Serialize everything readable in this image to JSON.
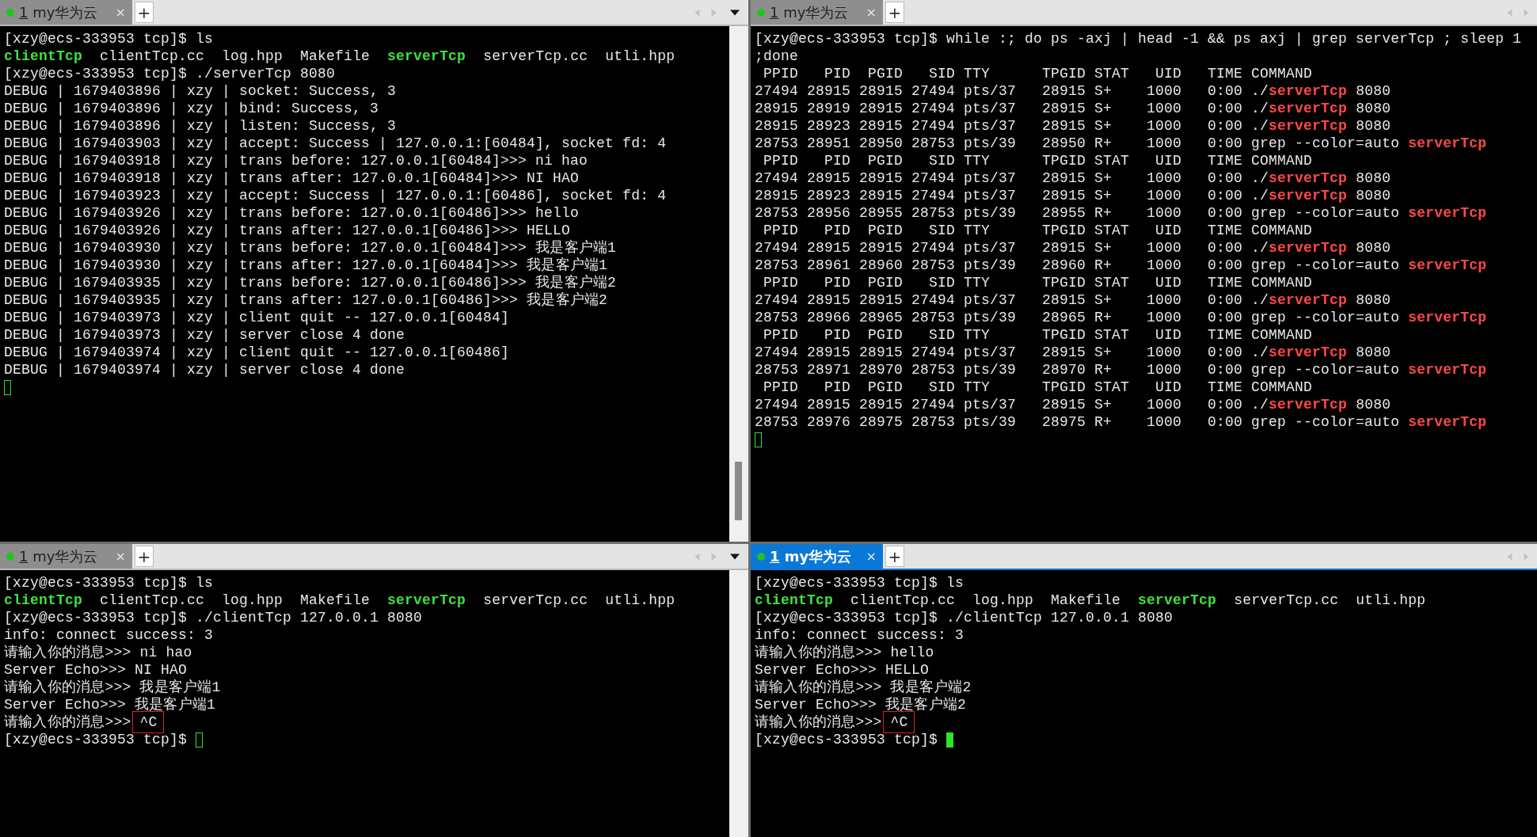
{
  "panes": [
    {
      "tab": {
        "index": "1",
        "title": " my华为云",
        "close": "×",
        "selected": false
      },
      "new_tab": "+",
      "menu_caret": true,
      "scrollbar": true,
      "scrollbar_thumb": true,
      "lines": [
        {
          "spans": [
            {
              "text": "[xzy@ecs-333953 tcp]$ ls",
              "kind": "plain"
            }
          ]
        },
        {
          "spans": [
            {
              "text": "clientTcp",
              "kind": "executable"
            },
            {
              "text": "  clientTcp.cc  log.hpp  Makefile  ",
              "kind": "plain"
            },
            {
              "text": "serverTcp",
              "kind": "executable"
            },
            {
              "text": "  serverTcp.cc  utli.hpp",
              "kind": "plain"
            }
          ]
        },
        {
          "spans": [
            {
              "text": "[xzy@ecs-333953 tcp]$ ./serverTcp 8080",
              "kind": "plain"
            }
          ]
        },
        {
          "spans": [
            {
              "text": "DEBUG | 1679403896 | xzy | socket: Success, 3",
              "kind": "plain"
            }
          ]
        },
        {
          "spans": [
            {
              "text": "DEBUG | 1679403896 | xzy | bind: Success, 3",
              "kind": "plain"
            }
          ]
        },
        {
          "spans": [
            {
              "text": "DEBUG | 1679403896 | xzy | listen: Success, 3",
              "kind": "plain"
            }
          ]
        },
        {
          "spans": [
            {
              "text": "DEBUG | 1679403903 | xzy | accept: Success | 127.0.0.1:[60484], socket fd: 4",
              "kind": "plain"
            }
          ]
        },
        {
          "spans": [
            {
              "text": "DEBUG | 1679403918 | xzy | trans before: 127.0.0.1[60484]>>> ni hao",
              "kind": "plain"
            }
          ]
        },
        {
          "spans": [
            {
              "text": "DEBUG | 1679403918 | xzy | trans after: 127.0.0.1[60484]>>> NI HAO",
              "kind": "plain"
            }
          ]
        },
        {
          "spans": [
            {
              "text": "DEBUG | 1679403923 | xzy | accept: Success | 127.0.0.1:[60486], socket fd: 4",
              "kind": "plain"
            }
          ]
        },
        {
          "spans": [
            {
              "text": "DEBUG | 1679403926 | xzy | trans before: 127.0.0.1[60486]>>> hello",
              "kind": "plain"
            }
          ]
        },
        {
          "spans": [
            {
              "text": "DEBUG | 1679403926 | xzy | trans after: 127.0.0.1[60486]>>> HELLO",
              "kind": "plain"
            }
          ]
        },
        {
          "spans": [
            {
              "text": "DEBUG | 1679403930 | xzy | trans before: 127.0.0.1[60484]>>> 我是客户端1",
              "kind": "plain"
            }
          ]
        },
        {
          "spans": [
            {
              "text": "DEBUG | 1679403930 | xzy | trans after: 127.0.0.1[60484]>>> 我是客户端1",
              "kind": "plain"
            }
          ]
        },
        {
          "spans": [
            {
              "text": "DEBUG | 1679403935 | xzy | trans before: 127.0.0.1[60486]>>> 我是客户端2",
              "kind": "plain"
            }
          ]
        },
        {
          "spans": [
            {
              "text": "DEBUG | 1679403935 | xzy | trans after: 127.0.0.1[60486]>>> 我是客户端2",
              "kind": "plain"
            }
          ]
        },
        {
          "spans": [
            {
              "text": "DEBUG | 1679403973 | xzy | client quit -- 127.0.0.1[60484]",
              "kind": "plain"
            }
          ]
        },
        {
          "spans": [
            {
              "text": "DEBUG | 1679403973 | xzy | server close 4 done",
              "kind": "plain"
            }
          ]
        },
        {
          "spans": [
            {
              "text": "DEBUG | 1679403974 | xzy | client quit -- 127.0.0.1[60486]",
              "kind": "plain"
            }
          ]
        },
        {
          "spans": [
            {
              "text": "DEBUG | 1679403974 | xzy | server close 4 done",
              "kind": "plain"
            }
          ]
        },
        {
          "cursor": true,
          "cursor_filled": false
        }
      ]
    },
    {
      "tab": {
        "index": "1",
        "title": " my华为云",
        "close": "×",
        "selected": false
      },
      "new_tab": "+",
      "menu_caret": false,
      "scrollbar": false,
      "lines": [
        {
          "spans": [
            {
              "text": "[xzy@ecs-333953 tcp]$ while :; do ps -axj | head -1 && ps axj | grep serverTcp ; sleep 1",
              "kind": "plain"
            }
          ]
        },
        {
          "spans": [
            {
              "text": ";done",
              "kind": "plain"
            }
          ]
        },
        {
          "spans": [
            {
              "text": " PPID   PID  PGID   SID TTY      TPGID STAT   UID   TIME COMMAND",
              "kind": "plain"
            }
          ]
        },
        {
          "spans": [
            {
              "text": "27494 28915 28915 27494 pts/37   28915 S+    1000   0:00 ./",
              "kind": "plain"
            },
            {
              "text": "serverTcp",
              "kind": "match"
            },
            {
              "text": " 8080",
              "kind": "plain"
            }
          ]
        },
        {
          "spans": [
            {
              "text": "28915 28919 28915 27494 pts/37   28915 S+    1000   0:00 ./",
              "kind": "plain"
            },
            {
              "text": "serverTcp",
              "kind": "match"
            },
            {
              "text": " 8080",
              "kind": "plain"
            }
          ]
        },
        {
          "spans": [
            {
              "text": "28915 28923 28915 27494 pts/37   28915 S+    1000   0:00 ./",
              "kind": "plain"
            },
            {
              "text": "serverTcp",
              "kind": "match"
            },
            {
              "text": " 8080",
              "kind": "plain"
            }
          ]
        },
        {
          "spans": [
            {
              "text": "28753 28951 28950 28753 pts/39   28950 R+    1000   0:00 grep --color=auto ",
              "kind": "plain"
            },
            {
              "text": "serverTcp",
              "kind": "match"
            }
          ]
        },
        {
          "spans": [
            {
              "text": " PPID   PID  PGID   SID TTY      TPGID STAT   UID   TIME COMMAND",
              "kind": "plain"
            }
          ]
        },
        {
          "spans": [
            {
              "text": "27494 28915 28915 27494 pts/37   28915 S+    1000   0:00 ./",
              "kind": "plain"
            },
            {
              "text": "serverTcp",
              "kind": "match"
            },
            {
              "text": " 8080",
              "kind": "plain"
            }
          ]
        },
        {
          "spans": [
            {
              "text": "28915 28923 28915 27494 pts/37   28915 S+    1000   0:00 ./",
              "kind": "plain"
            },
            {
              "text": "serverTcp",
              "kind": "match"
            },
            {
              "text": " 8080",
              "kind": "plain"
            }
          ]
        },
        {
          "spans": [
            {
              "text": "28753 28956 28955 28753 pts/39   28955 R+    1000   0:00 grep --color=auto ",
              "kind": "plain"
            },
            {
              "text": "serverTcp",
              "kind": "match"
            }
          ]
        },
        {
          "spans": [
            {
              "text": " PPID   PID  PGID   SID TTY      TPGID STAT   UID   TIME COMMAND",
              "kind": "plain"
            }
          ]
        },
        {
          "spans": [
            {
              "text": "27494 28915 28915 27494 pts/37   28915 S+    1000   0:00 ./",
              "kind": "plain"
            },
            {
              "text": "serverTcp",
              "kind": "match"
            },
            {
              "text": " 8080",
              "kind": "plain"
            }
          ]
        },
        {
          "spans": [
            {
              "text": "28753 28961 28960 28753 pts/39   28960 R+    1000   0:00 grep --color=auto ",
              "kind": "plain"
            },
            {
              "text": "serverTcp",
              "kind": "match"
            }
          ]
        },
        {
          "spans": [
            {
              "text": " PPID   PID  PGID   SID TTY      TPGID STAT   UID   TIME COMMAND",
              "kind": "plain"
            }
          ]
        },
        {
          "spans": [
            {
              "text": "27494 28915 28915 27494 pts/37   28915 S+    1000   0:00 ./",
              "kind": "plain"
            },
            {
              "text": "serverTcp",
              "kind": "match"
            },
            {
              "text": " 8080",
              "kind": "plain"
            }
          ]
        },
        {
          "spans": [
            {
              "text": "28753 28966 28965 28753 pts/39   28965 R+    1000   0:00 grep --color=auto ",
              "kind": "plain"
            },
            {
              "text": "serverTcp",
              "kind": "match"
            }
          ]
        },
        {
          "spans": [
            {
              "text": " PPID   PID  PGID   SID TTY      TPGID STAT   UID   TIME COMMAND",
              "kind": "plain"
            }
          ]
        },
        {
          "spans": [
            {
              "text": "27494 28915 28915 27494 pts/37   28915 S+    1000   0:00 ./",
              "kind": "plain"
            },
            {
              "text": "serverTcp",
              "kind": "match"
            },
            {
              "text": " 8080",
              "kind": "plain"
            }
          ]
        },
        {
          "spans": [
            {
              "text": "28753 28971 28970 28753 pts/39   28970 R+    1000   0:00 grep --color=auto ",
              "kind": "plain"
            },
            {
              "text": "serverTcp",
              "kind": "match"
            }
          ]
        },
        {
          "spans": [
            {
              "text": " PPID   PID  PGID   SID TTY      TPGID STAT   UID   TIME COMMAND",
              "kind": "plain"
            }
          ]
        },
        {
          "spans": [
            {
              "text": "27494 28915 28915 27494 pts/37   28915 S+    1000   0:00 ./",
              "kind": "plain"
            },
            {
              "text": "serverTcp",
              "kind": "match"
            },
            {
              "text": " 8080",
              "kind": "plain"
            }
          ]
        },
        {
          "spans": [
            {
              "text": "28753 28976 28975 28753 pts/39   28975 R+    1000   0:00 grep --color=auto ",
              "kind": "plain"
            },
            {
              "text": "serverTcp",
              "kind": "match"
            }
          ]
        },
        {
          "cursor": true,
          "cursor_filled": false
        }
      ]
    },
    {
      "tab": {
        "index": "1",
        "title": " my华为云",
        "close": "×",
        "selected": false
      },
      "new_tab": "+",
      "menu_caret": true,
      "scrollbar": true,
      "scrollbar_thumb": false,
      "lines": [
        {
          "spans": [
            {
              "text": "[xzy@ecs-333953 tcp]$ ls",
              "kind": "plain"
            }
          ]
        },
        {
          "spans": [
            {
              "text": "clientTcp",
              "kind": "executable"
            },
            {
              "text": "  clientTcp.cc  log.hpp  Makefile  ",
              "kind": "plain"
            },
            {
              "text": "serverTcp",
              "kind": "executable"
            },
            {
              "text": "  serverTcp.cc  utli.hpp",
              "kind": "plain"
            }
          ]
        },
        {
          "spans": [
            {
              "text": "[xzy@ecs-333953 tcp]$ ./clientTcp 127.0.0.1 8080",
              "kind": "plain"
            }
          ]
        },
        {
          "spans": [
            {
              "text": "info: connect success: 3",
              "kind": "plain"
            }
          ]
        },
        {
          "spans": [
            {
              "text": "请输入你的消息>>> ni hao",
              "kind": "plain"
            }
          ]
        },
        {
          "spans": [
            {
              "text": "Server Echo>>> NI HAO",
              "kind": "plain"
            }
          ]
        },
        {
          "spans": [
            {
              "text": "请输入你的消息>>> 我是客户端1",
              "kind": "plain"
            }
          ]
        },
        {
          "spans": [
            {
              "text": "Server Echo>>> 我是客户端1",
              "kind": "plain"
            }
          ]
        },
        {
          "spans": [
            {
              "text": "请输入你的消息>>>",
              "kind": "plain"
            },
            {
              "text": "^C",
              "kind": "boxed"
            }
          ]
        },
        {
          "spans": [
            {
              "text": "[xzy@ecs-333953 tcp]$ ",
              "kind": "plain"
            }
          ],
          "cursor": true,
          "cursor_filled": false
        }
      ]
    },
    {
      "tab": {
        "index": "1",
        "title": " my华为云",
        "close": "×",
        "selected": true
      },
      "new_tab": "+",
      "menu_caret": false,
      "scrollbar": false,
      "lines": [
        {
          "spans": [
            {
              "text": "[xzy@ecs-333953 tcp]$ ls",
              "kind": "plain"
            }
          ]
        },
        {
          "spans": [
            {
              "text": "clientTcp",
              "kind": "executable"
            },
            {
              "text": "  clientTcp.cc  log.hpp  Makefile  ",
              "kind": "plain"
            },
            {
              "text": "serverTcp",
              "kind": "executable"
            },
            {
              "text": "  serverTcp.cc  utli.hpp",
              "kind": "plain"
            }
          ]
        },
        {
          "spans": [
            {
              "text": "[xzy@ecs-333953 tcp]$ ./clientTcp 127.0.0.1 8080",
              "kind": "plain"
            }
          ]
        },
        {
          "spans": [
            {
              "text": "info: connect success: 3",
              "kind": "plain"
            }
          ]
        },
        {
          "spans": [
            {
              "text": "请输入你的消息>>> hello",
              "kind": "plain"
            }
          ]
        },
        {
          "spans": [
            {
              "text": "Server Echo>>> HELLO",
              "kind": "plain"
            }
          ]
        },
        {
          "spans": [
            {
              "text": "请输入你的消息>>> 我是客户端2",
              "kind": "plain"
            }
          ]
        },
        {
          "spans": [
            {
              "text": "Server Echo>>> 我是客户端2",
              "kind": "plain"
            }
          ]
        },
        {
          "spans": [
            {
              "text": "请输入你的消息>>>",
              "kind": "plain"
            },
            {
              "text": "^C",
              "kind": "boxed"
            }
          ]
        },
        {
          "spans": [
            {
              "text": "[xzy@ecs-333953 tcp]$ ",
              "kind": "plain"
            }
          ],
          "cursor": true,
          "cursor_filled": true
        }
      ]
    }
  ]
}
